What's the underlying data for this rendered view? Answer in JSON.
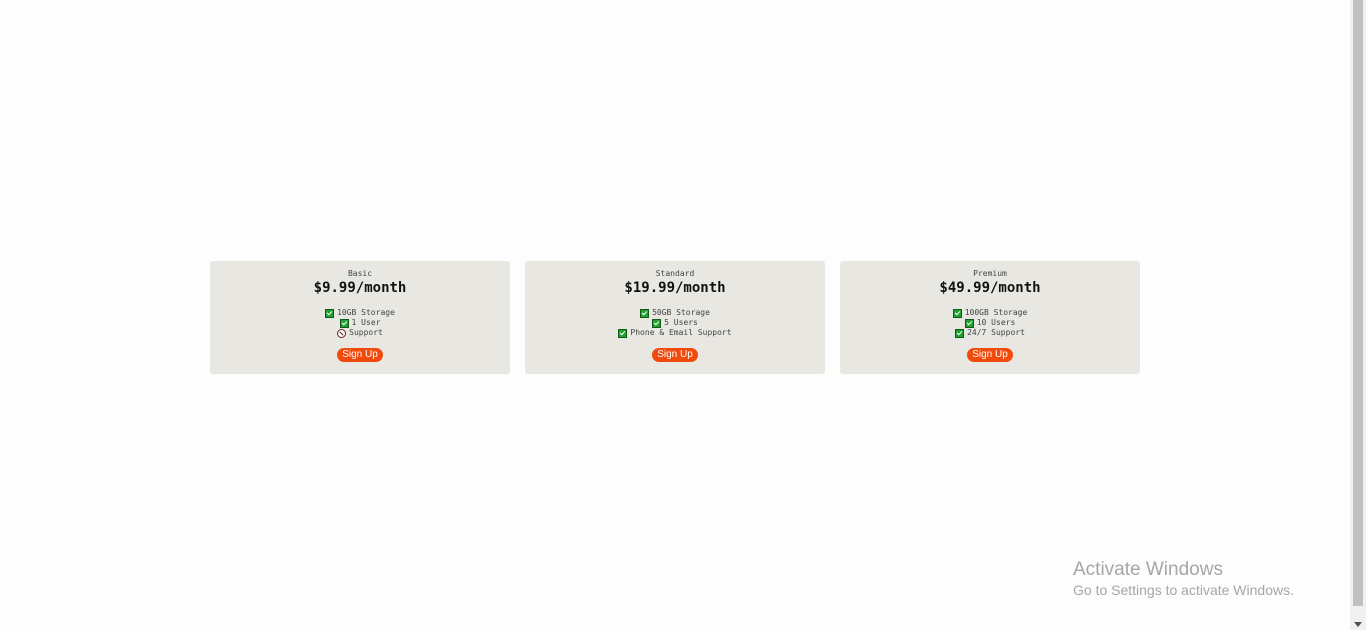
{
  "plans": [
    {
      "name": "Basic",
      "price": "$9.99/month",
      "features": [
        {
          "label": "10GB Storage",
          "icon": "check-icon"
        },
        {
          "label": "1 User",
          "icon": "check-icon"
        },
        {
          "label": "Support",
          "icon": "cross-icon"
        }
      ],
      "cta": "Sign Up"
    },
    {
      "name": "Standard",
      "price": "$19.99/month",
      "features": [
        {
          "label": "50GB Storage",
          "icon": "check-icon"
        },
        {
          "label": "5 Users",
          "icon": "check-icon"
        },
        {
          "label": "Phone & Email Support",
          "icon": "check-icon"
        }
      ],
      "cta": "Sign Up"
    },
    {
      "name": "Premium",
      "price": "$49.99/month",
      "features": [
        {
          "label": "100GB Storage",
          "icon": "check-icon"
        },
        {
          "label": "10 Users",
          "icon": "check-icon"
        },
        {
          "label": "24/7 Support",
          "icon": "check-icon"
        }
      ],
      "cta": "Sign Up"
    }
  ],
  "watermark": {
    "title": "Activate Windows",
    "subtitle": "Go to Settings to activate Windows."
  },
  "colors": {
    "card_bg": "#e8e7e2",
    "cta_bg": "#f04a0c",
    "check": "#1fa02f"
  }
}
